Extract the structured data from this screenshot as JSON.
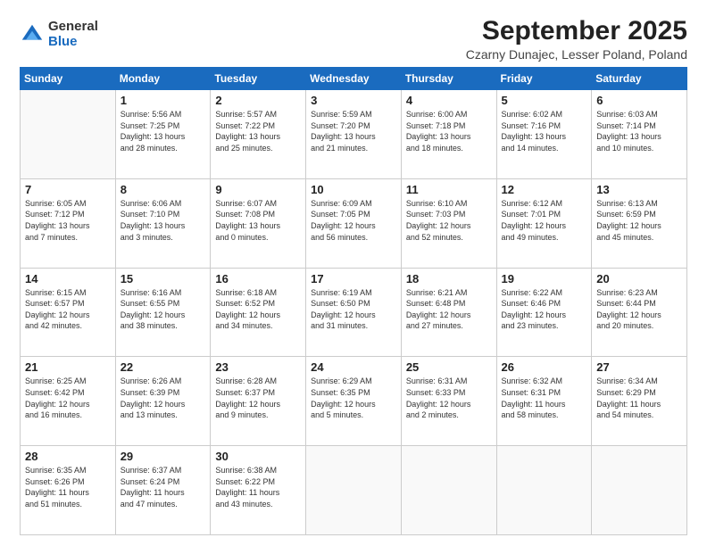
{
  "logo": {
    "general": "General",
    "blue": "Blue"
  },
  "title": "September 2025",
  "subtitle": "Czarny Dunajec, Lesser Poland, Poland",
  "headers": [
    "Sunday",
    "Monday",
    "Tuesday",
    "Wednesday",
    "Thursday",
    "Friday",
    "Saturday"
  ],
  "weeks": [
    [
      {
        "day": "",
        "content": ""
      },
      {
        "day": "1",
        "content": "Sunrise: 5:56 AM\nSunset: 7:25 PM\nDaylight: 13 hours\nand 28 minutes."
      },
      {
        "day": "2",
        "content": "Sunrise: 5:57 AM\nSunset: 7:22 PM\nDaylight: 13 hours\nand 25 minutes."
      },
      {
        "day": "3",
        "content": "Sunrise: 5:59 AM\nSunset: 7:20 PM\nDaylight: 13 hours\nand 21 minutes."
      },
      {
        "day": "4",
        "content": "Sunrise: 6:00 AM\nSunset: 7:18 PM\nDaylight: 13 hours\nand 18 minutes."
      },
      {
        "day": "5",
        "content": "Sunrise: 6:02 AM\nSunset: 7:16 PM\nDaylight: 13 hours\nand 14 minutes."
      },
      {
        "day": "6",
        "content": "Sunrise: 6:03 AM\nSunset: 7:14 PM\nDaylight: 13 hours\nand 10 minutes."
      }
    ],
    [
      {
        "day": "7",
        "content": "Sunrise: 6:05 AM\nSunset: 7:12 PM\nDaylight: 13 hours\nand 7 minutes."
      },
      {
        "day": "8",
        "content": "Sunrise: 6:06 AM\nSunset: 7:10 PM\nDaylight: 13 hours\nand 3 minutes."
      },
      {
        "day": "9",
        "content": "Sunrise: 6:07 AM\nSunset: 7:08 PM\nDaylight: 13 hours\nand 0 minutes."
      },
      {
        "day": "10",
        "content": "Sunrise: 6:09 AM\nSunset: 7:05 PM\nDaylight: 12 hours\nand 56 minutes."
      },
      {
        "day": "11",
        "content": "Sunrise: 6:10 AM\nSunset: 7:03 PM\nDaylight: 12 hours\nand 52 minutes."
      },
      {
        "day": "12",
        "content": "Sunrise: 6:12 AM\nSunset: 7:01 PM\nDaylight: 12 hours\nand 49 minutes."
      },
      {
        "day": "13",
        "content": "Sunrise: 6:13 AM\nSunset: 6:59 PM\nDaylight: 12 hours\nand 45 minutes."
      }
    ],
    [
      {
        "day": "14",
        "content": "Sunrise: 6:15 AM\nSunset: 6:57 PM\nDaylight: 12 hours\nand 42 minutes."
      },
      {
        "day": "15",
        "content": "Sunrise: 6:16 AM\nSunset: 6:55 PM\nDaylight: 12 hours\nand 38 minutes."
      },
      {
        "day": "16",
        "content": "Sunrise: 6:18 AM\nSunset: 6:52 PM\nDaylight: 12 hours\nand 34 minutes."
      },
      {
        "day": "17",
        "content": "Sunrise: 6:19 AM\nSunset: 6:50 PM\nDaylight: 12 hours\nand 31 minutes."
      },
      {
        "day": "18",
        "content": "Sunrise: 6:21 AM\nSunset: 6:48 PM\nDaylight: 12 hours\nand 27 minutes."
      },
      {
        "day": "19",
        "content": "Sunrise: 6:22 AM\nSunset: 6:46 PM\nDaylight: 12 hours\nand 23 minutes."
      },
      {
        "day": "20",
        "content": "Sunrise: 6:23 AM\nSunset: 6:44 PM\nDaylight: 12 hours\nand 20 minutes."
      }
    ],
    [
      {
        "day": "21",
        "content": "Sunrise: 6:25 AM\nSunset: 6:42 PM\nDaylight: 12 hours\nand 16 minutes."
      },
      {
        "day": "22",
        "content": "Sunrise: 6:26 AM\nSunset: 6:39 PM\nDaylight: 12 hours\nand 13 minutes."
      },
      {
        "day": "23",
        "content": "Sunrise: 6:28 AM\nSunset: 6:37 PM\nDaylight: 12 hours\nand 9 minutes."
      },
      {
        "day": "24",
        "content": "Sunrise: 6:29 AM\nSunset: 6:35 PM\nDaylight: 12 hours\nand 5 minutes."
      },
      {
        "day": "25",
        "content": "Sunrise: 6:31 AM\nSunset: 6:33 PM\nDaylight: 12 hours\nand 2 minutes."
      },
      {
        "day": "26",
        "content": "Sunrise: 6:32 AM\nSunset: 6:31 PM\nDaylight: 11 hours\nand 58 minutes."
      },
      {
        "day": "27",
        "content": "Sunrise: 6:34 AM\nSunset: 6:29 PM\nDaylight: 11 hours\nand 54 minutes."
      }
    ],
    [
      {
        "day": "28",
        "content": "Sunrise: 6:35 AM\nSunset: 6:26 PM\nDaylight: 11 hours\nand 51 minutes."
      },
      {
        "day": "29",
        "content": "Sunrise: 6:37 AM\nSunset: 6:24 PM\nDaylight: 11 hours\nand 47 minutes."
      },
      {
        "day": "30",
        "content": "Sunrise: 6:38 AM\nSunset: 6:22 PM\nDaylight: 11 hours\nand 43 minutes."
      },
      {
        "day": "",
        "content": ""
      },
      {
        "day": "",
        "content": ""
      },
      {
        "day": "",
        "content": ""
      },
      {
        "day": "",
        "content": ""
      }
    ]
  ]
}
